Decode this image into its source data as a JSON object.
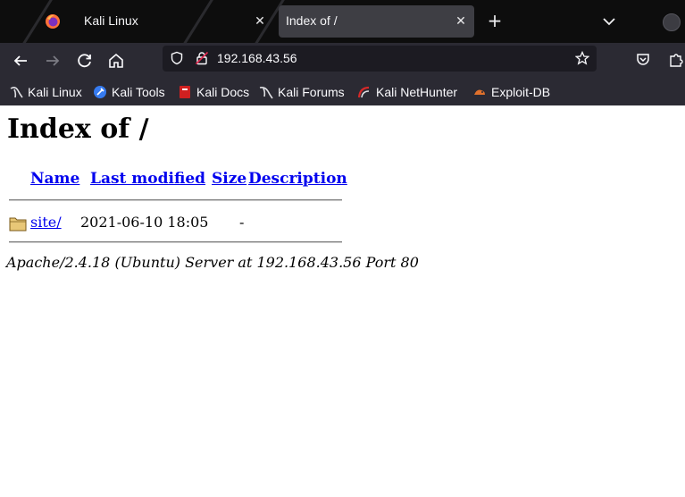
{
  "tabs": [
    {
      "title": "Kali Linux",
      "active": false
    },
    {
      "title": "Index of /",
      "active": true
    }
  ],
  "nav": {
    "url": "192.168.43.56"
  },
  "bookmarks": [
    {
      "label": "Kali Linux",
      "icon": "kali-dragon-icon"
    },
    {
      "label": "Kali Tools",
      "icon": "kali-tools-icon"
    },
    {
      "label": "Kali Docs",
      "icon": "kali-docs-icon"
    },
    {
      "label": "Kali Forums",
      "icon": "kali-forums-icon"
    },
    {
      "label": "Kali NetHunter",
      "icon": "nethunter-icon"
    },
    {
      "label": "Exploit-DB",
      "icon": "exploit-db-icon"
    }
  ],
  "page": {
    "heading": "Index of /",
    "columns": [
      "Name",
      "Last modified",
      "Size",
      "Description"
    ],
    "rows": [
      {
        "name": "site/",
        "modified": "2021-06-10 18:05",
        "size": "-",
        "description": "",
        "icon": "folder-icon"
      }
    ],
    "address": "Apache/2.4.18 (Ubuntu) Server at 192.168.43.56 Port 80"
  },
  "colors": {
    "link": "#0000ee",
    "toolbar": "#2b2a33",
    "tabstrip": "#0d0d0d",
    "active_tab": "#3e3e44"
  }
}
